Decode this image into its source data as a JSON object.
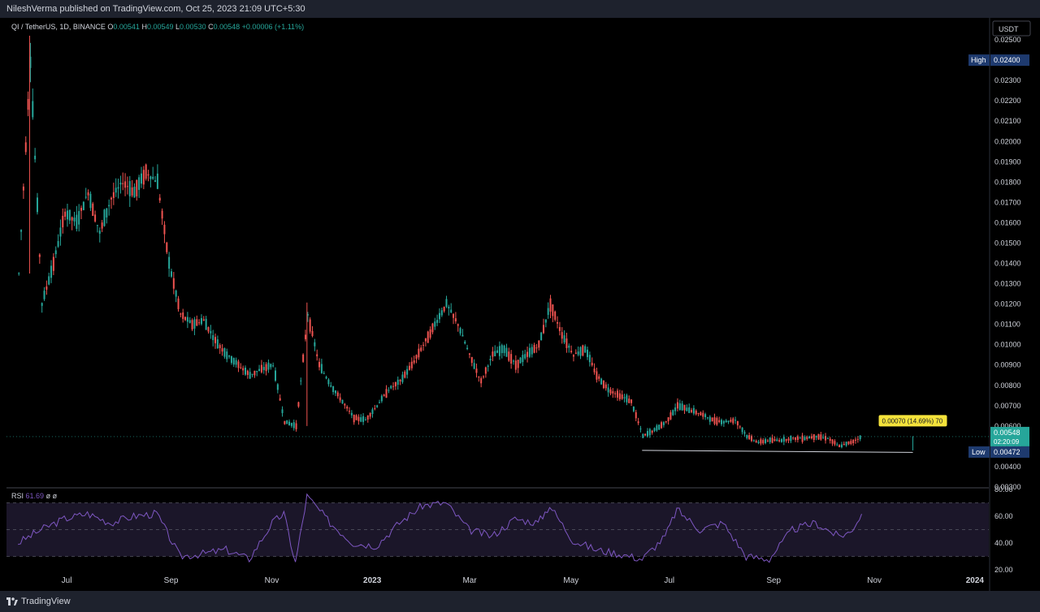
{
  "header": {
    "published": "NileshVerma published on TradingView.com, Oct 25, 2023 21:09 UTC+5:30"
  },
  "legend": {
    "symbol": "QI / TetherUS, 1D, BINANCE",
    "o_label": "O",
    "o": "0.00541",
    "h_label": "H",
    "h": "0.00549",
    "l_label": "L",
    "l": "0.00530",
    "c_label": "C",
    "c": "0.00548",
    "change": "+0.00006 (+1.11%)"
  },
  "rsi_legend": {
    "label": "RSI",
    "value": "61.69",
    "extra1": "ø",
    "extra2": "ø"
  },
  "footer": {
    "brand": "TradingView"
  },
  "colors": {
    "up": "#26a69a",
    "down": "#ef5350",
    "rsi": "#7e57c2",
    "rsi_band": "#1b1629",
    "background": "#000000",
    "frame": "#1e222d",
    "axis_text": "#d1d4dc",
    "badge": "#1e3a6e",
    "annotation": "#f5e33b"
  },
  "chart_data": [
    {
      "type": "candlestick",
      "title": "QI / TetherUS, 1D, BINANCE",
      "ylim": [
        0.003,
        0.026
      ],
      "y_ticks": [
        "0.00300",
        "0.00400",
        "0.00500",
        "0.00600",
        "0.00700",
        "0.00800",
        "0.00900",
        "0.01000",
        "0.01100",
        "0.01200",
        "0.01300",
        "0.01400",
        "0.01500",
        "0.01600",
        "0.01700",
        "0.01800",
        "0.01900",
        "0.02000",
        "0.02100",
        "0.02200",
        "0.02300",
        "0.02400",
        "0.02500"
      ],
      "x_ticks": [
        "Jul",
        "Sep",
        "Nov",
        "2023",
        "Mar",
        "May",
        "Jul",
        "Sep",
        "Nov",
        "2024"
      ],
      "currency": "USDT",
      "series": [
        {
          "name": "QI / TetherUS",
          "points": [
            [
              "2022-06-01",
              0.0135
            ],
            [
              "2022-06-08",
              0.024
            ],
            [
              "2022-06-15",
              0.012
            ],
            [
              "2022-06-22",
              0.014
            ],
            [
              "2022-06-29",
              0.0165
            ],
            [
              "2022-07-06",
              0.016
            ],
            [
              "2022-07-13",
              0.0175
            ],
            [
              "2022-07-20",
              0.0155
            ],
            [
              "2022-07-27",
              0.0172
            ],
            [
              "2022-08-03",
              0.018
            ],
            [
              "2022-08-10",
              0.0175
            ],
            [
              "2022-08-17",
              0.0185
            ],
            [
              "2022-08-24",
              0.018
            ],
            [
              "2022-08-31",
              0.014
            ],
            [
              "2022-09-07",
              0.0115
            ],
            [
              "2022-09-14",
              0.011
            ],
            [
              "2022-09-21",
              0.0112
            ],
            [
              "2022-09-28",
              0.0102
            ],
            [
              "2022-10-05",
              0.0095
            ],
            [
              "2022-10-12",
              0.009
            ],
            [
              "2022-10-19",
              0.0085
            ],
            [
              "2022-10-26",
              0.0088
            ],
            [
              "2022-11-02",
              0.009
            ],
            [
              "2022-11-09",
              0.0062
            ],
            [
              "2022-11-16",
              0.006
            ],
            [
              "2022-11-23",
              0.0115
            ],
            [
              "2022-11-30",
              0.009
            ],
            [
              "2022-12-07",
              0.008
            ],
            [
              "2022-12-14",
              0.0072
            ],
            [
              "2022-12-21",
              0.0064
            ],
            [
              "2022-12-28",
              0.0063
            ],
            [
              "2023-01-04",
              0.007
            ],
            [
              "2023-01-11",
              0.0078
            ],
            [
              "2023-01-18",
              0.0082
            ],
            [
              "2023-01-25",
              0.009
            ],
            [
              "2023-02-01",
              0.01
            ],
            [
              "2023-02-08",
              0.011
            ],
            [
              "2023-02-15",
              0.012
            ],
            [
              "2023-02-22",
              0.011
            ],
            [
              "2023-03-01",
              0.0095
            ],
            [
              "2023-03-08",
              0.0082
            ],
            [
              "2023-03-15",
              0.0095
            ],
            [
              "2023-03-22",
              0.0098
            ],
            [
              "2023-03-29",
              0.009
            ],
            [
              "2023-04-05",
              0.0095
            ],
            [
              "2023-04-12",
              0.01
            ],
            [
              "2023-04-19",
              0.012
            ],
            [
              "2023-04-26",
              0.0105
            ],
            [
              "2023-05-03",
              0.0095
            ],
            [
              "2023-05-10",
              0.0098
            ],
            [
              "2023-05-17",
              0.0085
            ],
            [
              "2023-05-24",
              0.0078
            ],
            [
              "2023-05-31",
              0.0075
            ],
            [
              "2023-06-07",
              0.0072
            ],
            [
              "2023-06-14",
              0.0055
            ],
            [
              "2023-06-21",
              0.0058
            ],
            [
              "2023-06-28",
              0.0062
            ],
            [
              "2023-07-05",
              0.007
            ],
            [
              "2023-07-12",
              0.0068
            ],
            [
              "2023-07-19",
              0.0066
            ],
            [
              "2023-07-26",
              0.0063
            ],
            [
              "2023-08-02",
              0.0062
            ],
            [
              "2023-08-09",
              0.0063
            ],
            [
              "2023-08-16",
              0.0055
            ],
            [
              "2023-08-23",
              0.0052
            ],
            [
              "2023-08-30",
              0.0053
            ],
            [
              "2023-09-06",
              0.0053
            ],
            [
              "2023-09-13",
              0.0054
            ],
            [
              "2023-09-20",
              0.0054
            ],
            [
              "2023-09-27",
              0.0055
            ],
            [
              "2023-10-04",
              0.0054
            ],
            [
              "2023-10-11",
              0.005
            ],
            [
              "2023-10-18",
              0.0052
            ],
            [
              "2023-10-25",
              0.00548
            ]
          ]
        }
      ],
      "badges": [
        {
          "label": "High",
          "value": "0.02400"
        },
        {
          "label": "Low",
          "value": "0.00472"
        }
      ],
      "last_price": "0.00548",
      "countdown": "02:20:09",
      "annotation": "0.00070 (14.69%) 70",
      "support_line": {
        "from": "2023-06-14",
        "to": "2023-11-25",
        "value_start": 0.0048,
        "value_end": 0.0047
      }
    },
    {
      "type": "line",
      "title": "RSI",
      "ylim": [
        20,
        80
      ],
      "y_ticks": [
        "20.00",
        "40.00",
        "60.00",
        "80.00"
      ],
      "bands": [
        30,
        50,
        70
      ],
      "series": [
        {
          "name": "RSI",
          "points": [
            [
              "2022-06-01",
              40
            ],
            [
              "2022-06-15",
              50
            ],
            [
              "2022-06-29",
              58
            ],
            [
              "2022-07-13",
              62
            ],
            [
              "2022-07-27",
              55
            ],
            [
              "2022-08-10",
              60
            ],
            [
              "2022-08-24",
              62
            ],
            [
              "2022-09-07",
              30
            ],
            [
              "2022-09-21",
              32
            ],
            [
              "2022-10-05",
              35
            ],
            [
              "2022-10-19",
              28
            ],
            [
              "2022-11-02",
              55
            ],
            [
              "2022-11-09",
              62
            ],
            [
              "2022-11-16",
              25
            ],
            [
              "2022-11-23",
              75
            ],
            [
              "2022-12-07",
              55
            ],
            [
              "2022-12-21",
              40
            ],
            [
              "2023-01-04",
              38
            ],
            [
              "2023-01-18",
              55
            ],
            [
              "2023-02-01",
              68
            ],
            [
              "2023-02-15",
              70
            ],
            [
              "2023-03-01",
              50
            ],
            [
              "2023-03-15",
              45
            ],
            [
              "2023-03-29",
              58
            ],
            [
              "2023-04-12",
              55
            ],
            [
              "2023-04-19",
              68
            ],
            [
              "2023-05-03",
              42
            ],
            [
              "2023-05-17",
              35
            ],
            [
              "2023-05-31",
              32
            ],
            [
              "2023-06-14",
              28
            ],
            [
              "2023-06-28",
              45
            ],
            [
              "2023-07-05",
              65
            ],
            [
              "2023-07-19",
              50
            ],
            [
              "2023-08-02",
              55
            ],
            [
              "2023-08-16",
              30
            ],
            [
              "2023-08-30",
              28
            ],
            [
              "2023-09-13",
              50
            ],
            [
              "2023-09-27",
              55
            ],
            [
              "2023-10-11",
              45
            ],
            [
              "2023-10-18",
              48
            ],
            [
              "2023-10-25",
              61.69
            ]
          ]
        }
      ]
    }
  ]
}
